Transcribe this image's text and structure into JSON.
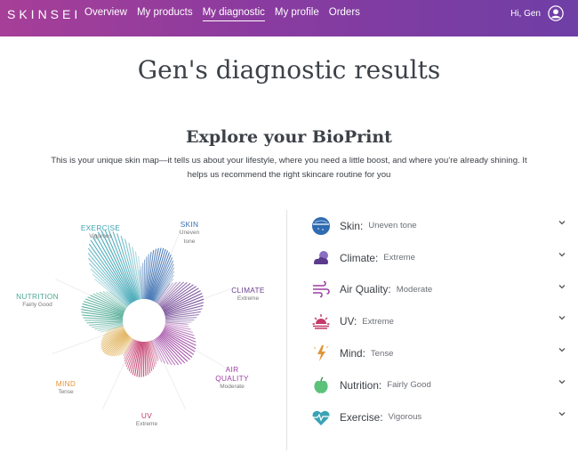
{
  "header": {
    "logo": "SKINSEI",
    "nav": [
      "Overview",
      "My products",
      "My diagnostic",
      "My profile",
      "Orders"
    ],
    "active_nav": "My diagnostic",
    "greeting": "Hi, Gen"
  },
  "page": {
    "title": "Gen's diagnostic results",
    "section_title": "Explore your BioPrint",
    "section_desc_line1": "This is your unique skin map—it tells us about your lifestyle, where you need a little boost, and where you’re already shining. It",
    "section_desc_line2": "helps us recommend the right skincare routine for you"
  },
  "bioprint": {
    "labels": [
      {
        "name": "EXERCISE",
        "value": "Vigorous",
        "color": "#3aa3b4"
      },
      {
        "name": "SKIN",
        "value_lines": [
          "Uneven",
          "tone"
        ],
        "color": "#3b6fb0"
      },
      {
        "name": "CLIMATE",
        "value": "Extreme",
        "color": "#6a3d8f"
      },
      {
        "name": "NUTRITION",
        "value": "Fairly Good",
        "color": "#4aa892"
      },
      {
        "name_lines": [
          "AIR",
          "QUALITY"
        ],
        "value": "Moderate",
        "color": "#9b3fa0"
      },
      {
        "name": "MIND",
        "value": "Tense",
        "color": "#e0953a"
      },
      {
        "name": "UV",
        "value": "Extreme",
        "color": "#c33a6b"
      }
    ]
  },
  "factors": [
    {
      "name": "Skin:",
      "value": "Uneven tone",
      "icon": "skin-icon",
      "color": "#2f6bb0"
    },
    {
      "name": "Climate:",
      "value": "Extreme",
      "icon": "cloud-moon-icon",
      "color": "#5b3a8c"
    },
    {
      "name": "Air Quality:",
      "value": "Moderate",
      "icon": "wind-icon",
      "color": "#9b3fa0"
    },
    {
      "name": "UV:",
      "value": "Extreme",
      "icon": "sun-icon",
      "color": "#c33a6b"
    },
    {
      "name": "Mind:",
      "value": "Tense",
      "icon": "brain-lightning-icon",
      "color": "#e0953a"
    },
    {
      "name": "Nutrition:",
      "value": "Fairly Good",
      "icon": "apple-icon",
      "color": "#5cc27a"
    },
    {
      "name": "Exercise:",
      "value": "Vigorous",
      "icon": "heart-pulse-icon",
      "color": "#3aa3b4"
    }
  ]
}
